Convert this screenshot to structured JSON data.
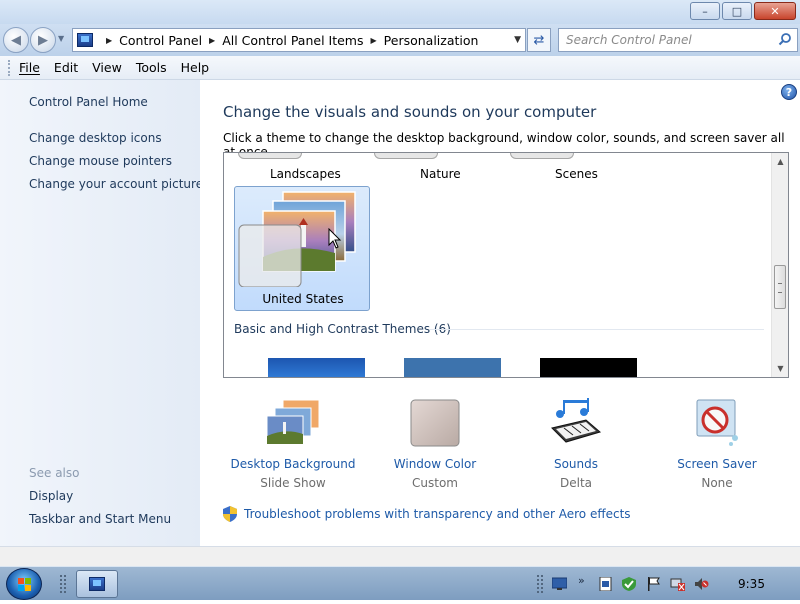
{
  "window": {
    "minimize": "–",
    "maximize": "□",
    "close": "✕"
  },
  "address": {
    "crumbs": [
      "Control Panel",
      "All Control Panel Items",
      "Personalization"
    ],
    "search_placeholder": "Search Control Panel"
  },
  "menu": [
    "File",
    "Edit",
    "View",
    "Tools",
    "Help"
  ],
  "sidebar": {
    "home": "Control Panel Home",
    "links": [
      "Change desktop icons",
      "Change mouse pointers",
      "Change your account picture"
    ],
    "see_also": "See also",
    "see_also_links": [
      "Display",
      "Taskbar and Start Menu"
    ]
  },
  "main": {
    "heading": "Change the visuals and sounds on your computer",
    "subtext": "Click a theme to change the desktop background, window color, sounds, and screen saver all at once.",
    "themes_row": [
      "Landscapes",
      "Nature",
      "Scenes"
    ],
    "selected_theme": "United States",
    "basic_group": "Basic and High Contrast Themes (6)",
    "basic_colors": [
      "#1f5fb8",
      "#3d73ad",
      "#000000"
    ]
  },
  "bottom": {
    "items": [
      {
        "link": "Desktop Background",
        "sub": "Slide Show",
        "icon": "desktop-background-icon"
      },
      {
        "link": "Window Color",
        "sub": "Custom",
        "icon": "window-color-icon"
      },
      {
        "link": "Sounds",
        "sub": "Delta",
        "icon": "sounds-icon"
      },
      {
        "link": "Screen Saver",
        "sub": "None",
        "icon": "screen-saver-icon"
      }
    ],
    "troubleshoot": "Troubleshoot problems with transparency and other Aero effects"
  },
  "taskbar": {
    "clock": "9:35"
  },
  "colors": {
    "link": "#1e5aa8",
    "heading": "#1e395b",
    "selection": "#c1dbfc"
  }
}
